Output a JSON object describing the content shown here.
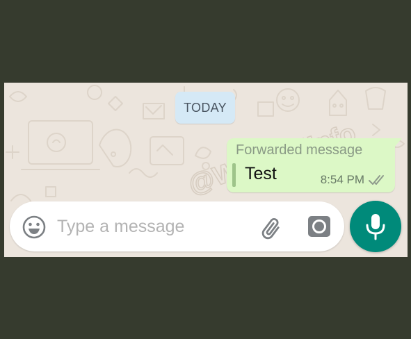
{
  "chat": {
    "date_label": "TODAY",
    "message": {
      "forwarded_label": "Forwarded message",
      "text": "Test",
      "time": "8:54 PM",
      "status_icon": "double-check-icon"
    },
    "watermark": "@WABetaInfo"
  },
  "composer": {
    "placeholder": "Type a message",
    "value": "",
    "emoji_icon": "emoji-icon",
    "attach_icon": "paperclip-icon",
    "camera_icon": "camera-icon",
    "mic_icon": "microphone-icon"
  },
  "colors": {
    "wallpaper": "#ece5dd",
    "outgoing_bubble": "#dcf8c6",
    "date_chip": "#d5e9f6",
    "accent": "#008a7a",
    "frame": "#363b2e"
  }
}
